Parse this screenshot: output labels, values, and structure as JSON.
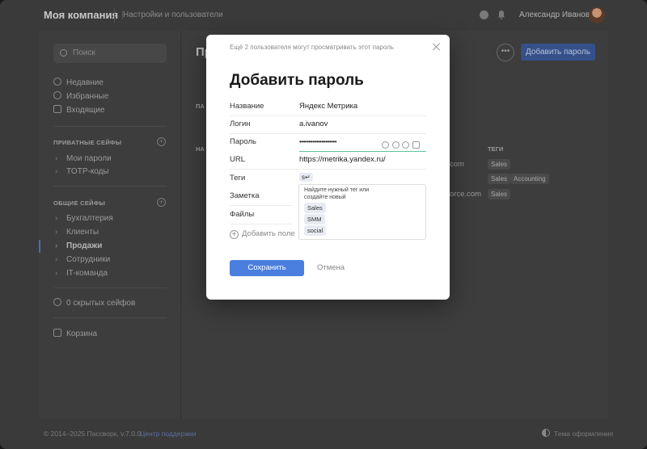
{
  "header": {
    "brand": "Моя компания",
    "nav": "Настройки и пользователи",
    "user": "Александр Иванов"
  },
  "sidebar": {
    "search_placeholder": "Поиск",
    "items": [
      {
        "label": "Недавние",
        "icon": "clock-icon"
      },
      {
        "label": "Избранные",
        "icon": "star-icon"
      },
      {
        "label": "Входящие",
        "icon": "inbox-icon"
      }
    ],
    "private_section": "ПРИВАТНЫЕ СЕЙФЫ",
    "private_items": [
      "Мои пароли",
      "TOTP-коды"
    ],
    "shared_section": "ОБЩИЕ СЕЙФЫ",
    "shared_items": [
      "Бухгалтерия",
      "Клиенты",
      "Продажи",
      "Сотрудники",
      "IT-команда"
    ],
    "hidden": "0 скрытых сейфов",
    "trash": "Корзина"
  },
  "main": {
    "title_initial": "Пр",
    "add_button": "Добавить пароль",
    "col_pass": "ПА",
    "col_name": "НА",
    "col_tags": "ТЕГИ",
    "rows": [
      {
        "domain": "com",
        "tags": [
          "Sales"
        ]
      },
      {
        "domain": "com",
        "tags": [
          "Sales",
          "Accounting"
        ]
      },
      {
        "domain": "orce.com",
        "tags": [
          "Sales"
        ]
      }
    ]
  },
  "footer": {
    "copyright": "© 2014–2025 Пассворк, v.7.0.0",
    "support": "Центр поддержки",
    "theme": "Тема оформления"
  },
  "modal": {
    "notice": "Ещё 2 пользователя могут просматривать этот пароль",
    "title": "Добавить пароль",
    "fields": {
      "name_label": "Название",
      "name_value": "Яндекс Метрика",
      "login_label": "Логин",
      "login_value": "a.ivanov",
      "password_label": "Пароль",
      "password_value": "••••••••••••••••••••",
      "url_label": "URL",
      "url_value": "https://metrika.yandex.ru/",
      "tags_label": "Теги",
      "tags_input": "s↵",
      "note_label": "Заметка",
      "files_label": "Файлы"
    },
    "tag_dropdown": {
      "hint": "Найдите нужный тег или создайте новый",
      "options": [
        "Sales",
        "SMM",
        "social"
      ]
    },
    "add_field": "Добавить поле",
    "save": "Сохранить",
    "cancel": "Отмена"
  }
}
